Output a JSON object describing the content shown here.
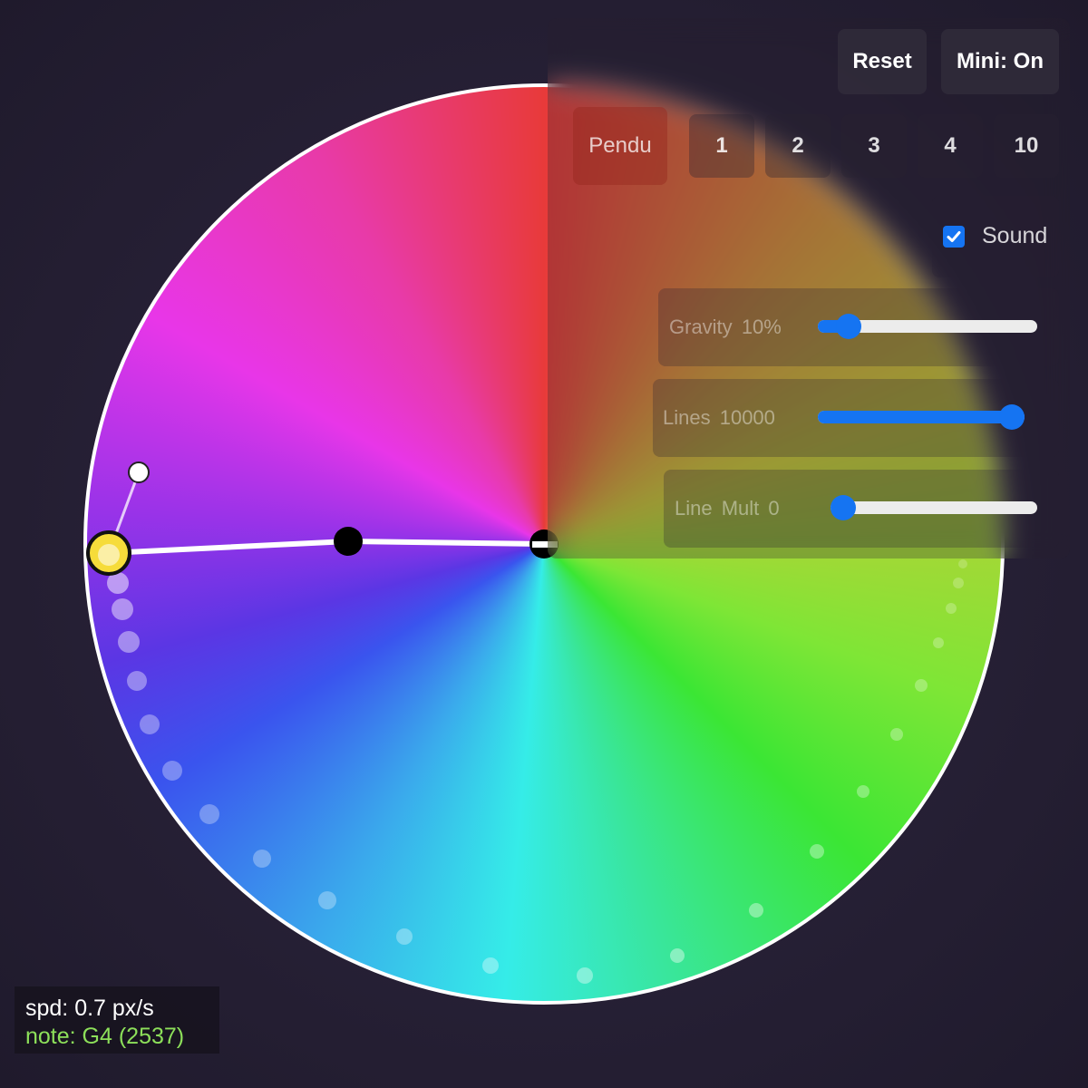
{
  "toolbar": {
    "reset_label": "Reset",
    "mini_label": "Mini: On"
  },
  "modes": {
    "items": [
      {
        "label": "Pendu",
        "active": true
      },
      {
        "label": "1",
        "active": false
      },
      {
        "label": "2",
        "active": false
      },
      {
        "label": "3",
        "active": false
      },
      {
        "label": "4",
        "active": false
      },
      {
        "label": "10",
        "active": false
      }
    ]
  },
  "sound": {
    "label": "Sound",
    "checked": true
  },
  "sliders": {
    "gravity": {
      "label": "Gravity",
      "value_text": "10%",
      "fraction": 0.14
    },
    "lines": {
      "label": "Lines",
      "value_text": "10000",
      "fraction": 1.0
    },
    "line_mult": {
      "label": "Line Mult",
      "value_text": "0",
      "fraction": 0.0
    }
  },
  "hud": {
    "speed": "spd: 0.7 px/s",
    "note": "note: G4 (2537)"
  },
  "colors": {
    "accent": "#1574f2",
    "bob": "#f6dc3a",
    "note_text": "#8de05a",
    "rim": "#ffffff"
  },
  "icons": {
    "sound_check": "checkmark-icon"
  }
}
